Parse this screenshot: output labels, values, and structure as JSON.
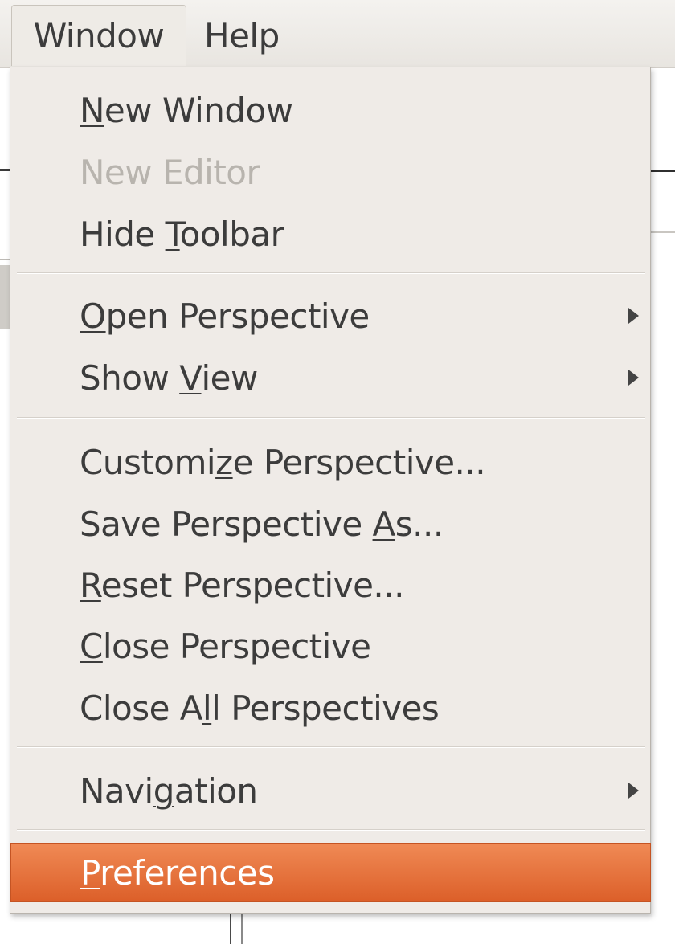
{
  "menubar": {
    "items": [
      {
        "label": "Window",
        "active": true
      },
      {
        "label": "Help",
        "active": false
      }
    ]
  },
  "menu": {
    "groups": [
      [
        {
          "pre": "",
          "mnemonic": "N",
          "post": "ew Window",
          "enabled": true,
          "submenu": false
        },
        {
          "pre": "New Editor",
          "mnemonic": "",
          "post": "",
          "enabled": false,
          "submenu": false
        },
        {
          "pre": "Hide ",
          "mnemonic": "T",
          "post": "oolbar",
          "enabled": true,
          "submenu": false
        }
      ],
      [
        {
          "pre": "",
          "mnemonic": "O",
          "post": "pen Perspective",
          "enabled": true,
          "submenu": true
        },
        {
          "pre": "Show ",
          "mnemonic": "V",
          "post": "iew",
          "enabled": true,
          "submenu": true
        }
      ],
      [
        {
          "pre": "Customi",
          "mnemonic": "z",
          "post": "e Perspective...",
          "enabled": true,
          "submenu": false
        },
        {
          "pre": "Save Perspective ",
          "mnemonic": "A",
          "post": "s...",
          "enabled": true,
          "submenu": false
        },
        {
          "pre": "",
          "mnemonic": "R",
          "post": "eset Perspective...",
          "enabled": true,
          "submenu": false
        },
        {
          "pre": "",
          "mnemonic": "C",
          "post": "lose Perspective",
          "enabled": true,
          "submenu": false
        },
        {
          "pre": "Close A",
          "mnemonic": "l",
          "post": "l Perspectives",
          "enabled": true,
          "submenu": false
        }
      ],
      [
        {
          "pre": "Navi",
          "mnemonic": "g",
          "post": "ation",
          "enabled": true,
          "submenu": true
        }
      ],
      [
        {
          "pre": "",
          "mnemonic": "P",
          "post": "references",
          "enabled": true,
          "submenu": false,
          "highlighted": true
        }
      ]
    ]
  },
  "colors": {
    "highlight": "#e2673a",
    "text": "#3c3c3c",
    "disabled_text": "#b8b4ae",
    "menu_bg": "#efebe7"
  }
}
